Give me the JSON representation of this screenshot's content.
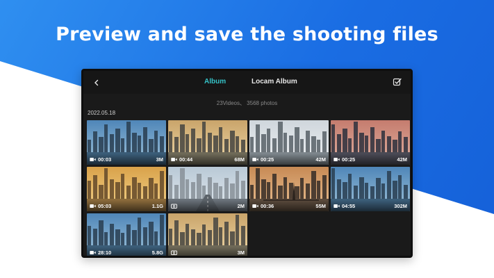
{
  "headline": "Preview and save the shooting files",
  "colors": {
    "brand_blue": "#1a6de3",
    "active_tab": "#35c3c8",
    "app_background": "#1a1a1a"
  },
  "appbar": {
    "back_icon": "chevron-left-icon",
    "tabs": [
      {
        "label": "Album",
        "active": true
      },
      {
        "label": "Locam Album",
        "active": false
      }
    ],
    "select_icon": "select-checkbox-icon"
  },
  "summary": "23Videos、 3568 photos",
  "groups": [
    {
      "date": "2022.05.18",
      "items": [
        {
          "duration": "00:03",
          "size": "3M",
          "icon": "video-icon",
          "scene": "blue-sky"
        },
        {
          "duration": "00:44",
          "size": "68M",
          "icon": "video-icon",
          "scene": "sunset"
        },
        {
          "duration": "00:25",
          "size": "42M",
          "icon": "video-icon",
          "scene": "white-sky"
        },
        {
          "duration": "00:25",
          "size": "42M",
          "icon": "video-icon",
          "scene": "dusk-pink"
        },
        {
          "duration": "05:03",
          "size": "1.1G",
          "icon": "video-icon",
          "scene": "golden"
        },
        {
          "duration": "",
          "size": "2M",
          "icon": "photo-icon",
          "scene": "highway"
        },
        {
          "duration": "00:36",
          "size": "55M",
          "icon": "video-icon",
          "scene": "bridge"
        },
        {
          "duration": "04:55",
          "size": "302M",
          "icon": "video-icon",
          "scene": "blue-sky"
        },
        {
          "duration": "28:10",
          "size": "5.8G",
          "icon": "video-icon",
          "scene": "blue-sky"
        },
        {
          "duration": "",
          "size": "3M",
          "icon": "photo-icon",
          "scene": "sunset"
        }
      ]
    }
  ]
}
